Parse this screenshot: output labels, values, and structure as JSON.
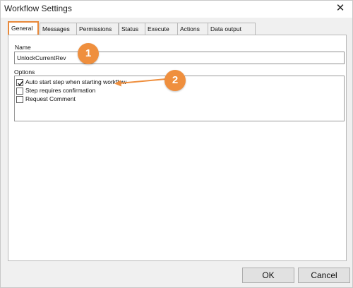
{
  "window": {
    "title": "Workflow Settings",
    "close_glyph": "✕"
  },
  "tabs": [
    {
      "label": "General",
      "active": true
    },
    {
      "label": "Messages",
      "active": false
    },
    {
      "label": "Permissions",
      "active": false
    },
    {
      "label": "Status",
      "active": false
    },
    {
      "label": "Execute",
      "active": false
    },
    {
      "label": "Actions",
      "active": false
    },
    {
      "label": "Data output",
      "active": false
    }
  ],
  "general": {
    "name_label": "Name",
    "name_value": "UnlockCurrentRev",
    "options_label": "Options",
    "options": [
      {
        "label": "Auto start step when starting workflow",
        "checked": true
      },
      {
        "label": "Step requires confirmation",
        "checked": false
      },
      {
        "label": "Request Comment",
        "checked": false
      }
    ]
  },
  "buttons": {
    "ok_label": "OK",
    "cancel_label": "Cancel"
  },
  "callouts": [
    {
      "number": "1"
    },
    {
      "number": "2"
    }
  ],
  "colors": {
    "accent_orange": "#ef8f3e",
    "active_tab_border": "#e8893a",
    "dialog_background": "#f0f0f0"
  },
  "icons": {
    "close": "close-icon",
    "check": "checkmark-icon",
    "arrow": "arrow-left-icon"
  }
}
